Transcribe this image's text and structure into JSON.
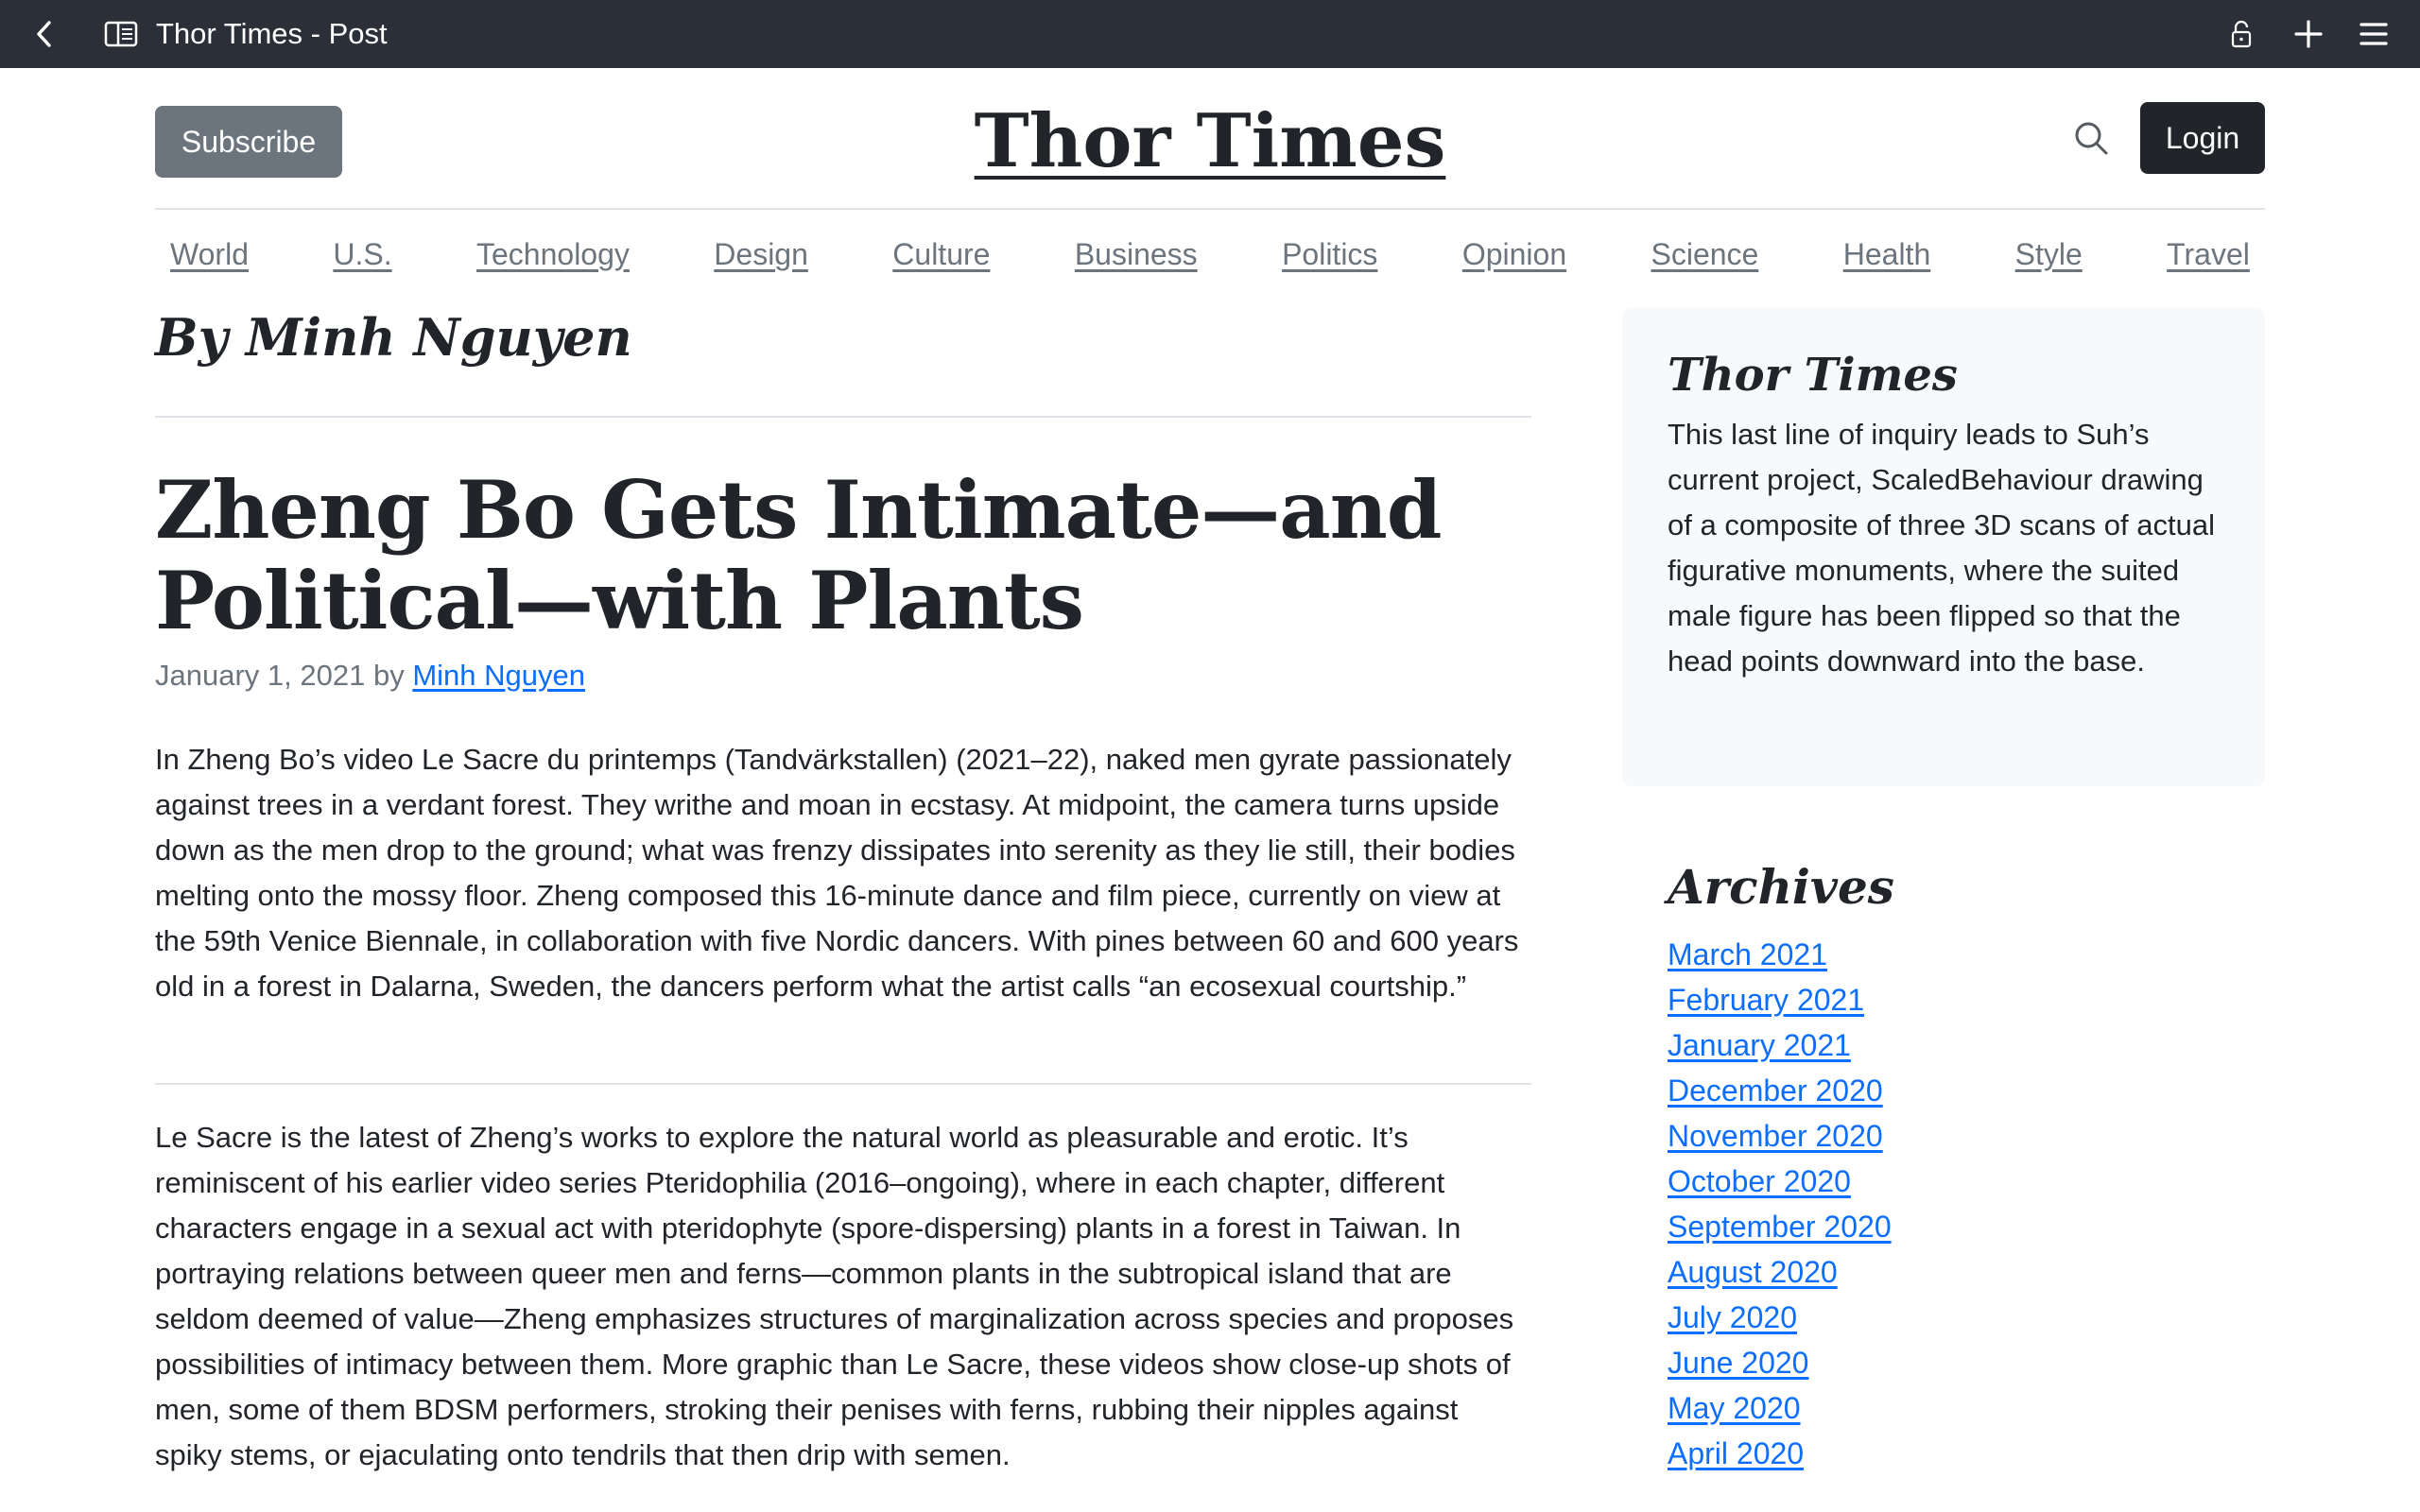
{
  "browser": {
    "tab_title": "Thor Times - Post"
  },
  "header": {
    "subscribe_label": "Subscribe",
    "site_title": "Thor Times",
    "login_label": "Login"
  },
  "nav": {
    "items": [
      "World",
      "U.S.",
      "Technology",
      "Design",
      "Culture",
      "Business",
      "Politics",
      "Opinion",
      "Science",
      "Health",
      "Style",
      "Travel"
    ]
  },
  "post": {
    "byline_heading": "By Minh Nguyen",
    "title": "Zheng Bo Gets Intimate—and Political—with Plants",
    "date": "January 1, 2021",
    "by_word": "by",
    "author": "Minh Nguyen",
    "paragraphs": [
      "In Zheng Bo’s video Le Sacre du printemps (Tandvärkstallen) (2021–22), naked men gyrate passionately against trees in a verdant forest. They writhe and moan in ecstasy. At midpoint, the camera turns upside down as the men drop to the ground; what was frenzy dissipates into serenity as they lie still, their bodies melting onto the mossy floor. Zheng composed this 16-minute dance and film piece, currently on view at the 59th Venice Biennale, in collaboration with five Nordic dancers. With pines between 60 and 600 years old in a forest in Dalarna, Sweden, the dancers perform what the artist calls “an ecosexual courtship.”",
      "Le Sacre is the latest of Zheng’s works to explore the natural world as pleasurable and erotic. It’s reminiscent of his earlier video series Pteridophilia (2016–ongoing), where in each chapter, different characters engage in a sexual act with pteridophyte (spore-dispersing) plants in a forest in Taiwan. In portraying relations between queer men and ferns—common plants in the subtropical island that are seldom deemed of value—Zheng emphasizes structures of marginalization across species and proposes possibilities of intimacy between them. More graphic than Le Sacre, these videos show close-up shots of men, some of them BDSM performers, stroking their penises with ferns, rubbing their nipples against spiky stems, or ejaculating onto tendrils that then drip with semen."
    ]
  },
  "sidebar": {
    "about_title": "Thor Times",
    "about_text": "This last line of inquiry leads to Suh’s current project, ScaledBehaviour drawing of a composite of three 3D scans of actual figurative monuments, where the suited male figure has been flipped so that the head points downward into the base.",
    "archives_title": "Archives",
    "archives": [
      "March 2021",
      "February 2021",
      "January 2021",
      "December 2020",
      "November 2020",
      "October 2020",
      "September 2020",
      "August 2020",
      "July 2020",
      "June 2020",
      "May 2020",
      "April 2020"
    ]
  },
  "icons": {
    "back": "chevron-left-icon",
    "reader": "reader-view-icon",
    "lock": "lock-icon",
    "plus": "plus-icon",
    "menu": "hamburger-menu-icon",
    "search": "search-icon"
  },
  "colors": {
    "toolbar_bg": "#2b2f37",
    "subscribe_bg": "#6c757d",
    "login_bg": "#212529",
    "link": "#0d6efd",
    "sidebar_bg": "#f8f9fa"
  }
}
